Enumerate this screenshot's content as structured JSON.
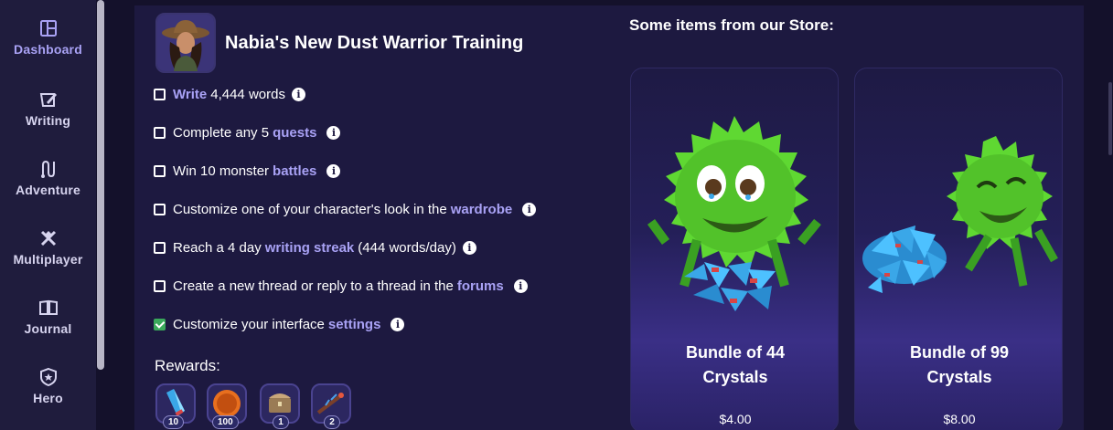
{
  "sidebar": {
    "items": [
      {
        "label": "Dashboard",
        "icon": "dashboard-icon",
        "active": true
      },
      {
        "label": "Writing",
        "icon": "writing-icon"
      },
      {
        "label": "Adventure",
        "icon": "adventure-icon"
      },
      {
        "label": "Multiplayer",
        "icon": "multiplayer-icon"
      },
      {
        "label": "Journal",
        "icon": "journal-icon"
      },
      {
        "label": "Hero",
        "icon": "hero-icon"
      }
    ]
  },
  "training": {
    "title": "Nabia's New Dust Warrior Training",
    "tasks": [
      {
        "pre": "",
        "link": "Write",
        "post": "4,444 words",
        "checked": false
      },
      {
        "pre": "Complete any 5",
        "link": "quests",
        "post": "",
        "checked": false
      },
      {
        "pre": "Win 10 monster",
        "link": "battles",
        "post": "",
        "checked": false
      },
      {
        "pre": "Customize one of your character's look in the",
        "link": "wardrobe",
        "post": "",
        "checked": false
      },
      {
        "pre": "Reach a 4 day",
        "link": "writing streak",
        "post": "(444 words/day)",
        "checked": false
      },
      {
        "pre": "Create a new thread or reply to a thread in the",
        "link": "forums",
        "post": "",
        "checked": false
      },
      {
        "pre": "Customize your interface",
        "link": "settings",
        "post": "",
        "checked": true
      }
    ],
    "info_glyph": "i"
  },
  "rewards": {
    "label": "Rewards:",
    "items": [
      {
        "icon": "crystal-icon",
        "count": "10"
      },
      {
        "icon": "coin-icon",
        "count": "100"
      },
      {
        "icon": "chest-icon",
        "count": "1"
      },
      {
        "icon": "firework-icon",
        "count": "2"
      }
    ]
  },
  "store": {
    "heading": "Some items from our Store:",
    "cards": [
      {
        "title_line1": "Bundle of 44",
        "title_line2": "Crystals",
        "price": "$4.00"
      },
      {
        "title_line1": "Bundle of 99",
        "title_line2": "Crystals",
        "price": "$8.00"
      }
    ]
  },
  "colors": {
    "accent": "#a9a2f5",
    "panel": "#1d1940",
    "sidebar": "#1f1c3d",
    "monster_green": "#5fd832",
    "check_green": "#3aa95b"
  }
}
